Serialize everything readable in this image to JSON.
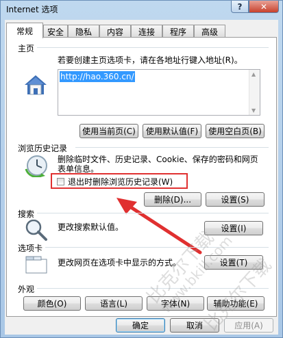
{
  "window": {
    "title": "Internet 选项",
    "help_glyph": "?",
    "close_glyph": "✕"
  },
  "tabs": [
    "常规",
    "安全",
    "隐私",
    "内容",
    "连接",
    "程序",
    "高级"
  ],
  "home": {
    "label": "主页",
    "description": "若要创建主页选项卡，请在各地址行键入地址(R)。",
    "url": "http://hao.360.cn/",
    "buttons": [
      "使用当前页(C)",
      "使用默认值(F)",
      "使用空白页(B)"
    ]
  },
  "history": {
    "label": "浏览历史记录",
    "description": "删除临时文件、历史记录、Cookie、保存的密码和网页表单信息。",
    "checkbox_label": "退出时删除浏览历史记录(W)",
    "buttons": [
      "删除(D)...",
      "设置(S)"
    ]
  },
  "search": {
    "label": "搜索",
    "description": "更改搜索默认值。",
    "button": "设置(I)"
  },
  "tabs_section": {
    "label": "选项卡",
    "description": "更改网页在选项卡中显示的方式。",
    "button": "设置(T)"
  },
  "appearance": {
    "label": "外观",
    "buttons": [
      "颜色(O)",
      "语言(L)",
      "字体(N)",
      "辅助功能(E)"
    ]
  },
  "footer": {
    "buttons": [
      "确定",
      "取消",
      "应用(A)"
    ]
  },
  "watermark": [
    "比克尔下载",
    "www.bkill.com",
    "比克尔下载"
  ],
  "colors": {
    "annotation": "#e03030",
    "selection": "#3399ff"
  }
}
